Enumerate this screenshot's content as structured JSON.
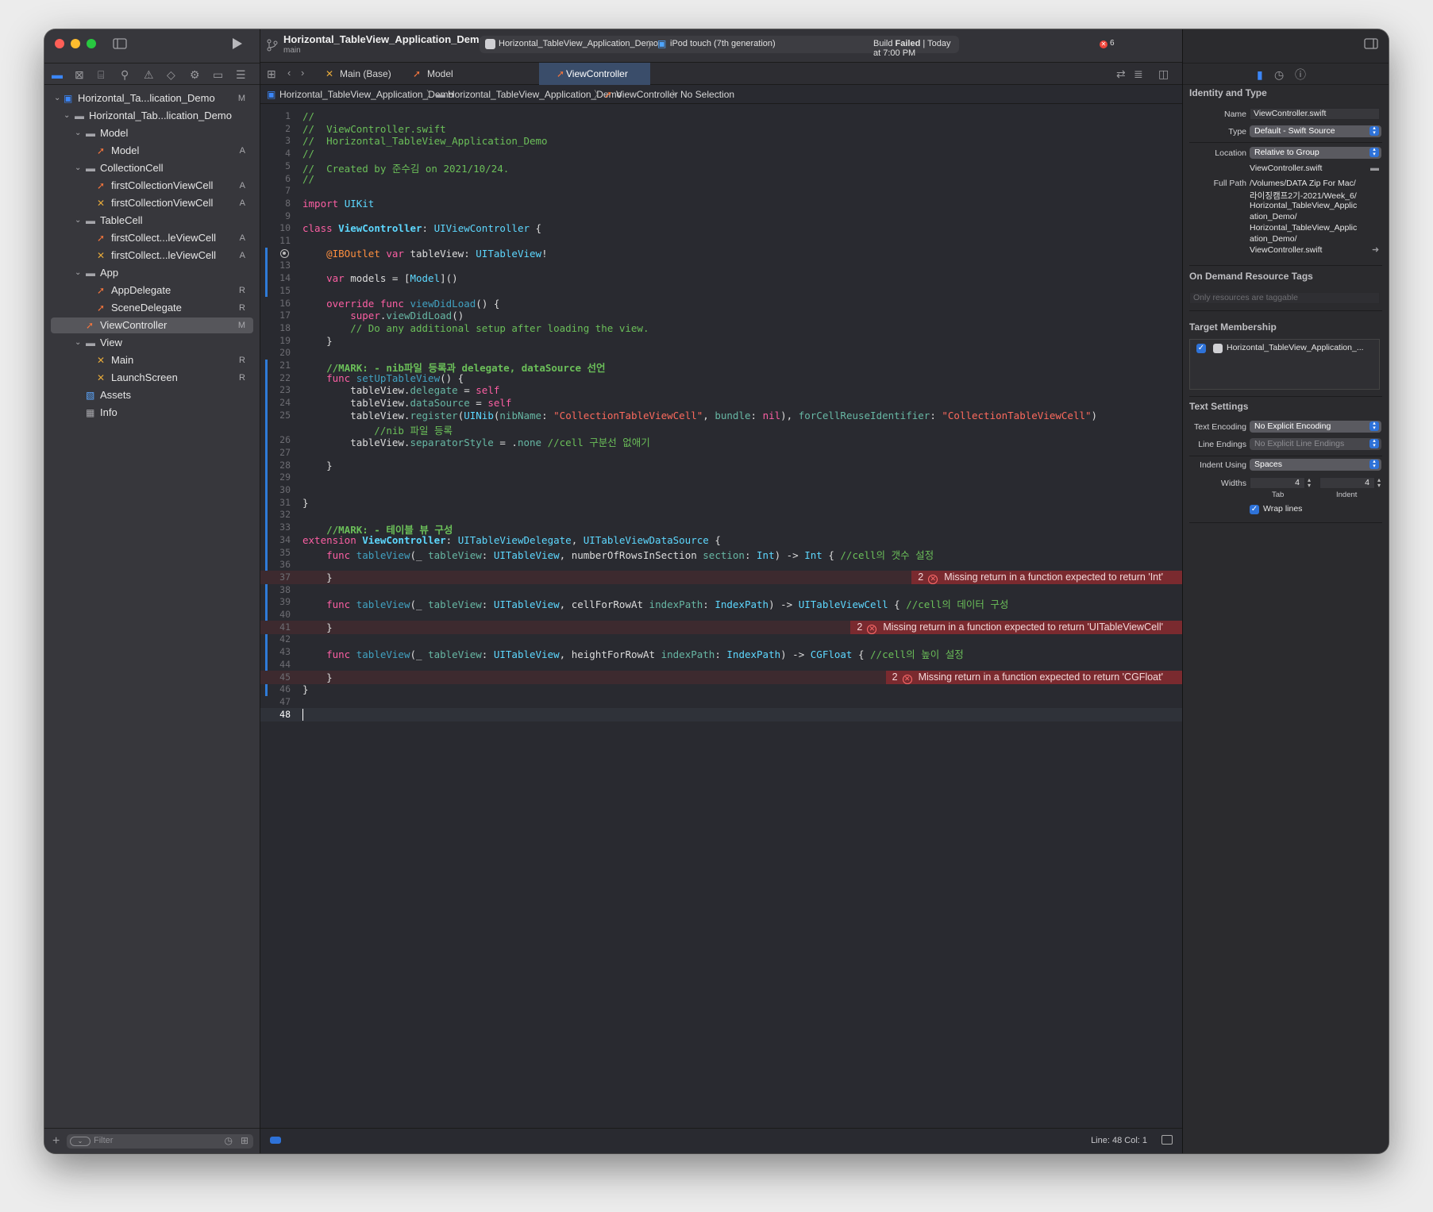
{
  "window": {
    "project_title": "Horizontal_TableView_Application_Demo",
    "branch": "main",
    "scheme": "Horizontal_TableView_Application_Demo",
    "device": "iPod touch (7th generation)",
    "build_status_prefix": "Build",
    "build_status_result": "Failed",
    "build_status_time": "| Today at 7:00 PM",
    "error_count": "6"
  },
  "navigator": {
    "filter_placeholder": "Filter",
    "items": [
      {
        "label": "Horizontal_Ta...lication_Demo",
        "status": "M"
      },
      {
        "label": "Horizontal_Tab...lication_Demo",
        "status": ""
      },
      {
        "label": "Model",
        "status": ""
      },
      {
        "label": "Model",
        "status": "A"
      },
      {
        "label": "CollectionCell",
        "status": ""
      },
      {
        "label": "firstCollectionViewCell",
        "status": "A"
      },
      {
        "label": "firstCollectionViewCell",
        "status": "A"
      },
      {
        "label": "TableCell",
        "status": ""
      },
      {
        "label": "firstCollect...leViewCell",
        "status": "A"
      },
      {
        "label": "firstCollect...leViewCell",
        "status": "A"
      },
      {
        "label": "App",
        "status": ""
      },
      {
        "label": "AppDelegate",
        "status": "R"
      },
      {
        "label": "SceneDelegate",
        "status": "R"
      },
      {
        "label": "ViewController",
        "status": "M"
      },
      {
        "label": "View",
        "status": ""
      },
      {
        "label": "Main",
        "status": "R"
      },
      {
        "label": "LaunchScreen",
        "status": "R"
      },
      {
        "label": "Assets",
        "status": ""
      },
      {
        "label": "Info",
        "status": ""
      }
    ]
  },
  "tabs": [
    "Main (Base)",
    "Model",
    "ViewController"
  ],
  "jumpbar": [
    "Horizontal_TableView_Application_Demo",
    "Horizontal_TableView_Application_Demo",
    "ViewController",
    "No Selection"
  ],
  "code": {
    "lines": [
      "//",
      "//  ViewController.swift",
      "//  Horizontal_TableView_Application_Demo",
      "//",
      "//  Created by 준수김 on 2021/10/24.",
      "//",
      "",
      "import UIKit",
      "",
      "class ViewController: UIViewController {",
      "",
      "    @IBOutlet var tableView: UITableView!",
      "",
      "    var models = [Model]()",
      "",
      "    override func viewDidLoad() {",
      "        super.viewDidLoad()",
      "        // Do any additional setup after loading the view.",
      "    }",
      "",
      "    //MARK: - nib파일 등록과 delegate, dataSource 선언",
      "    func setUpTableView() {",
      "        tableView.delegate = self",
      "        tableView.dataSource = self",
      "        tableView.register(UINib(nibName: \"CollectionTableViewCell\", bundle: nil), forCellReuseIdentifier: \"CollectionTableViewCell\")",
      "            //nib 파일 등록",
      "        tableView.separatorStyle = .none //cell 구분선 없애기",
      "",
      "    }",
      "",
      "",
      "}",
      "",
      "    //MARK: - 테이블 뷰 구성",
      "extension ViewController: UITableViewDelegate, UITableViewDataSource {",
      "    func tableView(_ tableView: UITableView, numberOfRowsInSection section: Int) -> Int { //cell의 갯수 설정",
      "",
      "    }",
      "",
      "    func tableView(_ tableView: UITableView, cellForRowAt indexPath: IndexPath) -> UITableViewCell { //cell의 데이터 구성",
      "",
      "    }",
      "",
      "    func tableView(_ tableView: UITableView, heightForRowAt indexPath: IndexPath) -> CGFloat { //cell의 높이 설정",
      "",
      "    }",
      "}",
      "",
      ""
    ],
    "line_numbers": [
      "1",
      "2",
      "3",
      "4",
      "5",
      "6",
      "7",
      "8",
      "9",
      "10",
      "11",
      "12",
      "13",
      "14",
      "15",
      "16",
      "17",
      "18",
      "19",
      "20",
      "21",
      "22",
      "23",
      "24",
      "25",
      "",
      "26",
      "27",
      "28",
      "29",
      "30",
      "31",
      "32",
      "33",
      "34",
      "35",
      "36",
      "37",
      "38",
      "39",
      "40",
      "41",
      "42",
      "43",
      "44",
      "45",
      "46",
      "47",
      "48"
    ],
    "errors": [
      {
        "count": "2",
        "message": "Missing return in a function expected to return 'Int'"
      },
      {
        "count": "2",
        "message": "Missing return in a function expected to return 'UITableViewCell'"
      },
      {
        "count": "2",
        "message": "Missing return in a function expected to return 'CGFloat'"
      }
    ]
  },
  "status": {
    "position": "Line: 48  Col: 1"
  },
  "inspector": {
    "identity_header": "Identity and Type",
    "name_label": "Name",
    "name_value": "ViewController.swift",
    "type_label": "Type",
    "type_value": "Default - Swift Source",
    "location_label": "Location",
    "location_value": "Relative to Group",
    "location_file": "ViewController.swift",
    "fullpath_label": "Full Path",
    "fullpath_lines": [
      "/Volumes/DATA Zip For Mac/",
      "라이징캠프2기-2021/Week_6/",
      "Horizontal_TableView_Applic",
      "ation_Demo/",
      "Horizontal_TableView_Applic",
      "ation_Demo/",
      "ViewController.swift"
    ],
    "ondemand_header": "On Demand Resource Tags",
    "ondemand_placeholder": "Only resources are taggable",
    "target_header": "Target Membership",
    "target_item": "Horizontal_TableView_Application_...",
    "text_header": "Text Settings",
    "encoding_label": "Text Encoding",
    "encoding_value": "No Explicit Encoding",
    "endings_label": "Line Endings",
    "endings_value": "No Explicit Line Endings",
    "indent_label": "Indent Using",
    "indent_value": "Spaces",
    "widths_label": "Widths",
    "tab_width": "4",
    "indent_width": "4",
    "tab_caption": "Tab",
    "indent_caption": "Indent",
    "wrap_label": "Wrap lines"
  },
  "colors": {
    "accent": "#2e72d8",
    "error_bg": "#7a2a2f",
    "editor_bg": "#292a30"
  }
}
